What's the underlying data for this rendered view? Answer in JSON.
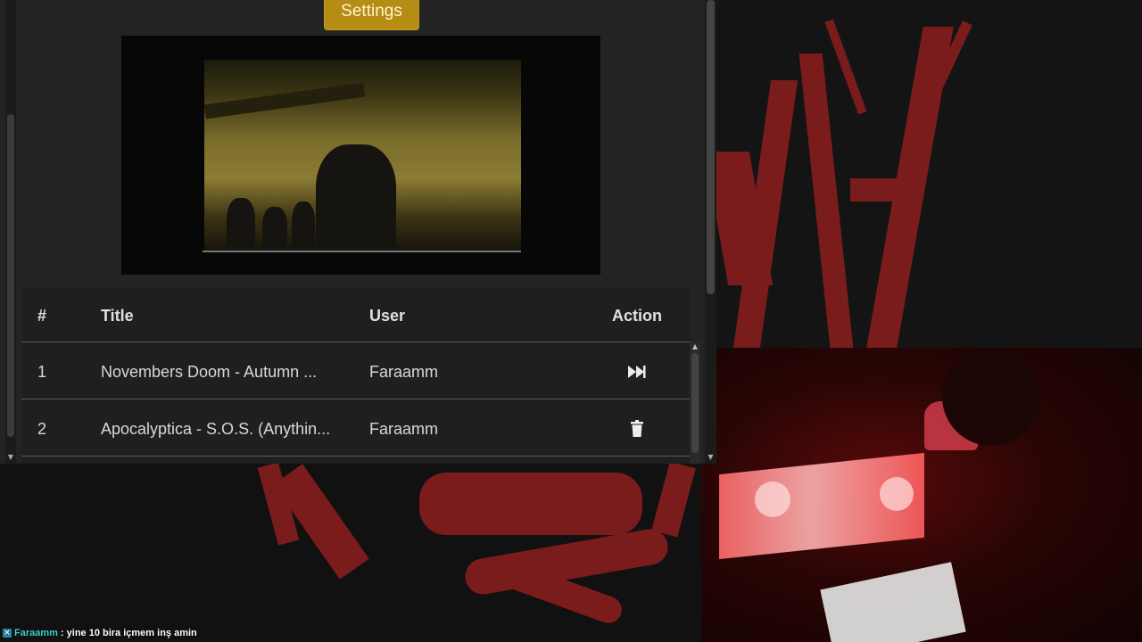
{
  "panel": {
    "settings_label": "Settings"
  },
  "queue_table": {
    "headers": {
      "index": "#",
      "title": "Title",
      "user": "User",
      "action": "Action"
    },
    "rows": [
      {
        "index": "1",
        "title": "Novembers Doom - Autumn ...",
        "user": "Faraamm",
        "action_icon": "fast-forward-icon"
      },
      {
        "index": "2",
        "title": "Apocalyptica - S.O.S. (Anythin...",
        "user": "Faraamm",
        "action_icon": "trash-icon"
      }
    ]
  },
  "chat": {
    "username": "Faraamm",
    "message": ": yine 10 bira içmem inş amin"
  },
  "colors": {
    "settings_button": "#b58d14",
    "panel_bg": "#232323",
    "table_bg": "#1f1f1f",
    "chat_username": "#3fd1c8",
    "art_red": "#7a1c1c"
  }
}
